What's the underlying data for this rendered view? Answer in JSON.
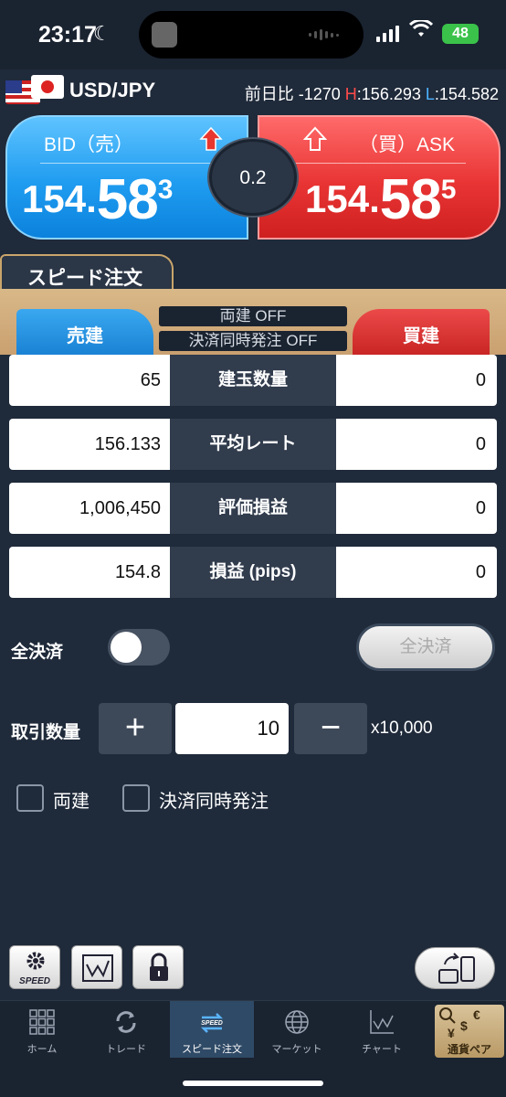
{
  "status_bar": {
    "time": "23:17",
    "battery": "48"
  },
  "pair": {
    "name": "USD/JPY",
    "change_label": "前日比",
    "change_value": "-1270",
    "high_label": "H",
    "high_value": "156.293",
    "low_label": "L",
    "low_value": "154.582"
  },
  "bid": {
    "label": "BID（売）",
    "price_main": "154.",
    "price_big": "58",
    "price_sup": "3"
  },
  "ask": {
    "label": "（買）ASK",
    "price_main": "154.",
    "price_big": "58",
    "price_sup": "5"
  },
  "spread": "0.2",
  "speed_order": {
    "tab_label": "スピード注文",
    "sell_label": "売建",
    "buy_label": "買建",
    "hedge_mode": "両建 OFF",
    "simul_mode": "決済同時発注 OFF"
  },
  "rows": [
    {
      "left": "65",
      "label": "建玉数量",
      "right": "0"
    },
    {
      "left": "156.133",
      "label": "平均レート",
      "right": "0"
    },
    {
      "left": "1,006,450",
      "label": "評価損益",
      "right": "0"
    },
    {
      "left": "154.8",
      "label": "損益 (pips)",
      "right": "0"
    }
  ],
  "close_all": {
    "label": "全決済",
    "button": "全決済",
    "toggle_on": false
  },
  "quantity": {
    "label": "取引数量",
    "plus": "+",
    "minus": "−",
    "value": "10",
    "unit": "x10,000"
  },
  "options": {
    "hedge": "両建",
    "simultaneous": "決済同時発注"
  },
  "tools": {
    "speed_text": "SPEED"
  },
  "nav": [
    {
      "label": "ホーム",
      "icon": "home-grid-icon"
    },
    {
      "label": "トレード",
      "icon": "trade-arrows-icon"
    },
    {
      "label": "スピード注文",
      "icon": "speed-icon",
      "active": true
    },
    {
      "label": "マーケット",
      "icon": "globe-icon"
    },
    {
      "label": "チャート",
      "icon": "chart-icon"
    },
    {
      "label": "通貨ペア",
      "icon": "currency-icon"
    }
  ],
  "colors": {
    "bid": "#1f9cf0",
    "ask": "#e93434",
    "high": "#ff4b4b",
    "low": "#4db3ff",
    "gold": "#caa070"
  }
}
